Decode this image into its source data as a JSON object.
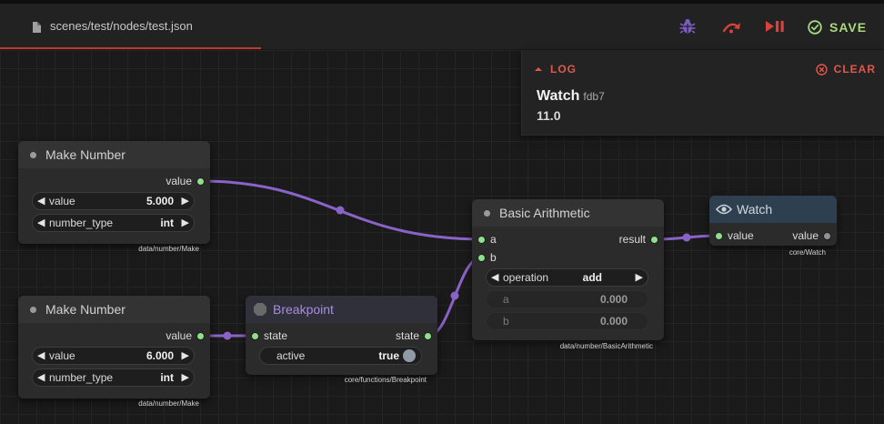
{
  "toolbar": {
    "tab_label": "scenes/test/nodes/test.json",
    "save_label": "SAVE",
    "colors": {
      "debug": "#7b5cc4",
      "step": "#d9423a",
      "play_pause": "#d9423a",
      "save": "#a8d87f"
    }
  },
  "log": {
    "title": "LOG",
    "clear_label": "CLEAR",
    "entry": {
      "name": "Watch",
      "id": "fdb7",
      "value": "11.0"
    }
  },
  "nodes": {
    "make_number_1": {
      "title": "Make Number",
      "output": "value",
      "widgets": [
        {
          "name": "value",
          "value": "5.000"
        },
        {
          "name": "number_type",
          "value": "int"
        }
      ],
      "path": "data/number/Make"
    },
    "make_number_2": {
      "title": "Make Number",
      "output": "value",
      "widgets": [
        {
          "name": "value",
          "value": "6.000"
        },
        {
          "name": "number_type",
          "value": "int"
        }
      ],
      "path": "data/number/Make"
    },
    "breakpoint": {
      "title": "Breakpoint",
      "input": "state",
      "output": "state",
      "toggle": {
        "name": "active",
        "value": "true"
      },
      "path": "core/functions/Breakpoint"
    },
    "basic_arithmetic": {
      "title": "Basic Arithmetic",
      "inputs": [
        "a",
        "b"
      ],
      "output": "result",
      "operation": {
        "name": "operation",
        "value": "add"
      },
      "params": [
        {
          "name": "a",
          "value": "0.000"
        },
        {
          "name": "b",
          "value": "0.000"
        }
      ],
      "path": "data/number/BasicArithmetic"
    },
    "watch": {
      "title": "Watch",
      "input": "value",
      "output": "value",
      "path": "core/Watch"
    }
  }
}
